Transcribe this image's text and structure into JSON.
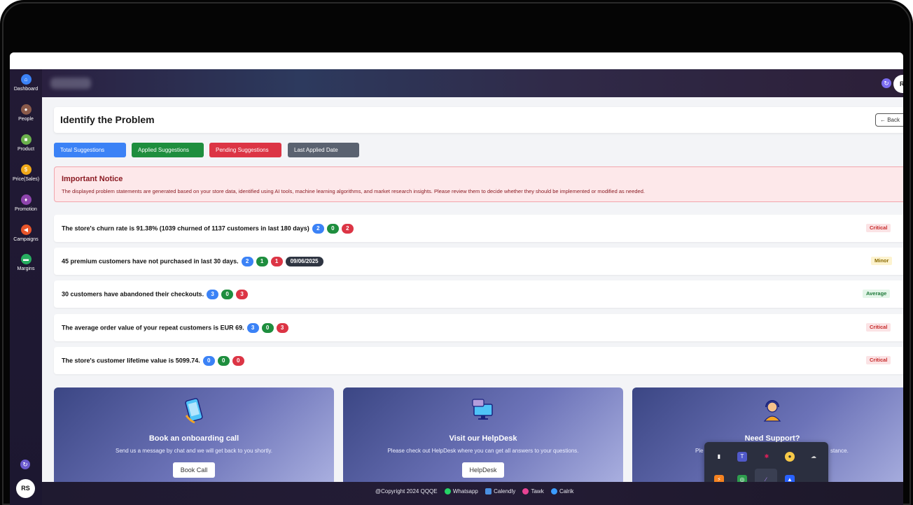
{
  "sidebar": {
    "items": [
      {
        "label": "Dashboard",
        "icon": "home-icon",
        "color": "#3b82f6"
      },
      {
        "label": "People",
        "icon": "person-icon",
        "color": "#8a5a4a"
      },
      {
        "label": "Product",
        "icon": "box-icon",
        "color": "#6ab04c"
      },
      {
        "label": "Price(Sales)",
        "icon": "dollar-icon",
        "color": "#f0a818"
      },
      {
        "label": "Promotion",
        "icon": "gift-icon",
        "color": "#8e44ad"
      },
      {
        "label": "Campaigns",
        "icon": "megaphone-icon",
        "color": "#e8552a"
      },
      {
        "label": "Margins",
        "icon": "cash-icon",
        "color": "#27ae60"
      }
    ],
    "avatar": "RS"
  },
  "header": {
    "avatar": "R"
  },
  "page": {
    "title": "Identify the Problem",
    "back_label": "← Back"
  },
  "tabs": [
    {
      "label": "Total Suggestions",
      "color": "#3b82f6"
    },
    {
      "label": "Applied Suggestions",
      "color": "#1e8e3e"
    },
    {
      "label": "Pending Suggestions",
      "color": "#dc3545"
    },
    {
      "label": "Last Applied Date",
      "color": "#5a6270"
    }
  ],
  "notice": {
    "title": "Important Notice",
    "text": "The displayed problem statements are generated based on your store data, identified using AI tools, machine learning algorithms, and market research insights. Please review them to decide whether they should be implemented or modified as needed."
  },
  "problems": [
    {
      "text": "The store's churn rate is 91.38% (1039 churned of 1137 customers in last 180 days)",
      "total": "2",
      "applied": "0",
      "pending": "2",
      "date": "",
      "severity": "Critical"
    },
    {
      "text": "45 premium customers have not purchased in last 30 days.",
      "total": "2",
      "applied": "1",
      "pending": "1",
      "date": "09/06/2025",
      "severity": "Minor"
    },
    {
      "text": "30 customers have abandoned their checkouts.",
      "total": "3",
      "applied": "0",
      "pending": "3",
      "date": "",
      "severity": "Average"
    },
    {
      "text": "The average order value of your repeat customers is EUR 69.",
      "total": "3",
      "applied": "0",
      "pending": "3",
      "date": "",
      "severity": "Critical"
    },
    {
      "text": "The store's customer lifetime value is 5099.74.",
      "total": "0",
      "applied": "0",
      "pending": "0",
      "date": "",
      "severity": "Critical"
    }
  ],
  "promos": [
    {
      "title": "Book an onboarding call",
      "text": "Send us a message by chat and we will get back to you shortly.",
      "button": "Book Call",
      "icon": "phone-call-icon"
    },
    {
      "title": "Visit our HelpDesk",
      "text": "Please check out HelpDesk where you can get all answers to your questions.",
      "button": "HelpDesk",
      "icon": "helpdesk-monitor-icon"
    },
    {
      "title": "Need Support?",
      "text_left": "Ple",
      "text_right": "stance.",
      "icon": "support-agent-icon"
    }
  ],
  "footer": {
    "copyright": "@Copyright 2024 QQQE",
    "links": [
      {
        "label": "Whatsapp",
        "icon": "whatsapp-icon",
        "color": "#25d366"
      },
      {
        "label": "Calendly",
        "icon": "calendar-icon",
        "color": "#4a90e2"
      },
      {
        "label": "Tawk",
        "icon": "chat-bubble-icon",
        "color": "#e84393"
      },
      {
        "label": "Calrik",
        "icon": "phone-icon",
        "color": "#3b9cff"
      }
    ]
  }
}
